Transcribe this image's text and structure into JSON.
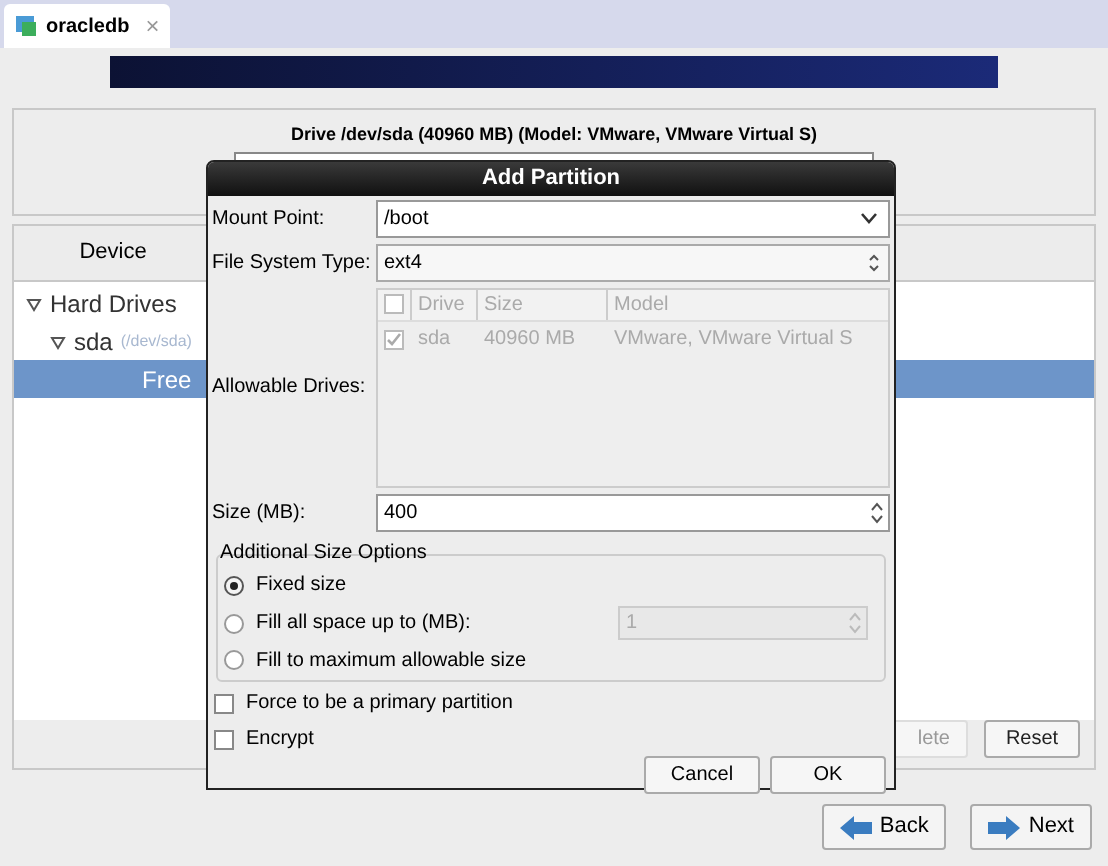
{
  "tab": {
    "title": "oracledb",
    "close": "×"
  },
  "drive": {
    "title": "Drive /dev/sda (40960 MB) (Model: VMware, VMware Virtual S)"
  },
  "device_panel": {
    "column": "Device",
    "tree": [
      {
        "label": "Hard Drives",
        "expanded": true,
        "selected": false,
        "children": [
          {
            "label": "sda",
            "hint": "(/dev/sda)",
            "expanded": true,
            "selected": false,
            "children": [
              {
                "label": "Free",
                "selected": true
              }
            ]
          }
        ]
      }
    ],
    "buttons": [
      {
        "label": "lete",
        "disabled": true
      },
      {
        "label": "Reset",
        "disabled": false
      }
    ]
  },
  "nav": [
    {
      "label": "Back",
      "kind": "back"
    },
    {
      "label": "Next",
      "kind": "next"
    }
  ],
  "dialog": {
    "title": "Add Partition",
    "mount_point": {
      "label": "Mount Point:",
      "value": "/boot"
    },
    "fs_type": {
      "label": "File System Type:",
      "value": "ext4"
    },
    "drives": {
      "label": "Allowable Drives:",
      "all_checked": false,
      "columns": [
        "Drive",
        "Size",
        "Model"
      ],
      "rows": [
        {
          "checked": true,
          "cells": [
            "sda",
            "40960 MB",
            "VMware, VMware Virtual S"
          ]
        }
      ]
    },
    "size": {
      "label": "Size (MB):",
      "value": "400"
    },
    "options": {
      "title": "Additional Size Options",
      "items": [
        {
          "label": "Fixed size",
          "selected": true
        },
        {
          "label": "Fill all space up to (MB):",
          "selected": false,
          "value": "1"
        },
        {
          "label": "Fill to maximum allowable size",
          "selected": false
        }
      ]
    },
    "checks": [
      {
        "label": "Force to be a primary partition",
        "checked": false
      },
      {
        "label": "Encrypt",
        "checked": false
      }
    ],
    "buttons": [
      "Cancel",
      "OK"
    ]
  }
}
